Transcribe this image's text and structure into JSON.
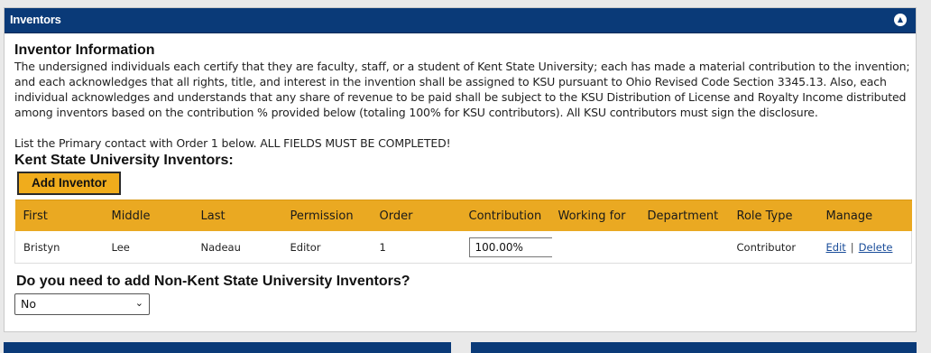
{
  "panel": {
    "title": "Inventors"
  },
  "info": {
    "heading": "Inventor Information",
    "paragraph": "The undersigned individuals each certify that they are faculty, staff, or a student of Kent State University; each has made a material contribution to the invention; and each acknowledges that all rights, title, and interest in the invention shall be assigned to KSU pursuant to Ohio Revised Code Section 3345.13. Also, each individual acknowledges and understands that any share of revenue to be paid shall be subject to the KSU Distribution of License and Royalty Income distributed among inventors based on the contribution % provided below (totaling 100% for KSU contributors). All KSU contributors must sign the disclosure.",
    "instruction": "List the Primary contact with Order 1 below. ALL FIELDS MUST BE COMPLETED!"
  },
  "ksu": {
    "heading": "Kent State University Inventors:",
    "add_button": "Add Inventor",
    "columns": [
      "First",
      "Middle",
      "Last",
      "Permission",
      "Order",
      "Contribution",
      "Working for",
      "Department",
      "Role Type",
      "Manage"
    ],
    "rows": [
      {
        "first": "Bristyn",
        "middle": "Lee",
        "last": "Nadeau",
        "permission": "Editor",
        "order": "1",
        "contribution": "100.00%",
        "working_for": "",
        "department": "",
        "role_type": "Contributor",
        "edit": "Edit",
        "separator": "|",
        "delete": "Delete"
      }
    ]
  },
  "non_ksu": {
    "question": "Do you need to add Non-Kent State University Inventors?",
    "selected": "No"
  },
  "icons": {
    "collapse": "chevron-double-up-icon",
    "dropdown": "chevron-down-icon"
  },
  "colors": {
    "header_bg": "#0a3a78",
    "accent": "#eaa922",
    "link": "#1a4d9a"
  }
}
